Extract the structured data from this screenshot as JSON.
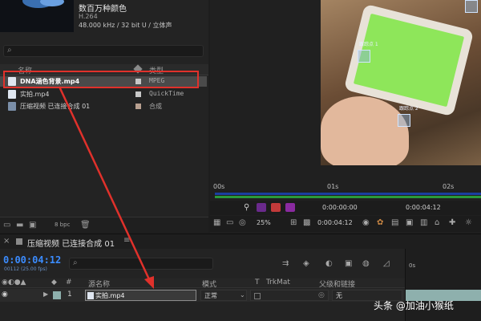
{
  "project": {
    "meta_title": "数百万种颜色",
    "meta_codec": "H.264",
    "meta_audio": "48.000 kHz / 32 bit U / 立体声",
    "columns": {
      "name": "名称",
      "type": "类型"
    },
    "items": [
      {
        "name": "DNA涵色背景.mp4",
        "type": "MPEG",
        "tag_color": "#c8c8c8"
      },
      {
        "name": "实拍.mp4",
        "type": "QuickTime",
        "tag_color": "#c8c8c8"
      },
      {
        "name": "压缩视频 已连接合成 01",
        "type": "合成",
        "tag_color": "#b8a090"
      }
    ],
    "bpc": "8 bpc"
  },
  "viewer": {
    "trackers": [
      "跟踪点 1",
      "跟踪点 2"
    ],
    "time_labels": [
      "00s",
      "01s",
      "02s"
    ],
    "controls1": {
      "time_start": "0:00:00:00",
      "time_end": "0:00:04:12"
    },
    "controls2": {
      "zoom": "25%",
      "current": "0:00:04:12"
    }
  },
  "timeline": {
    "tab_name": "压缩视频 已连接合成 01",
    "timecode": "0:00:04:12",
    "fps": "00112 (25.00 fps)",
    "ruler_start": "0s",
    "headers": {
      "num": "#",
      "source_name": "源名称",
      "mode": "模式",
      "t": "T",
      "trkmat": "TrkMat",
      "parent": "父级和链接"
    },
    "layer": {
      "index": "1",
      "name": "实拍.mp4",
      "mode": "正常",
      "parent": "无"
    }
  },
  "watermark": "头条 @加油小猴纸",
  "colors": {
    "highlight_red": "#e0312b",
    "timecode_blue": "#3b8cff",
    "green_screen": "#8ee65a"
  }
}
